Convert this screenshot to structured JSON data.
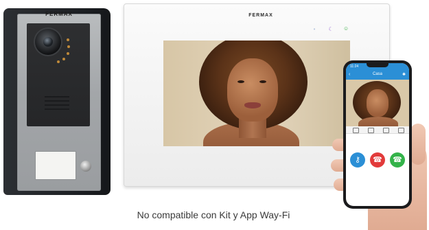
{
  "door_panel": {
    "brand": "FERMAX"
  },
  "monitor": {
    "brand": "FERMAX",
    "touch_icons": [
      "menu-icon",
      "moon-icon",
      "answer-icon"
    ]
  },
  "phone": {
    "status_time": "11:24",
    "app_title": "Casa",
    "call_buttons": [
      "key-button",
      "hangup-button",
      "answer-button"
    ],
    "colors": {
      "key": "#2b8fd6",
      "hangup": "#e23b3b",
      "answer": "#34b34a"
    }
  },
  "caption": "No compatible con Kit y App Way-Fi"
}
